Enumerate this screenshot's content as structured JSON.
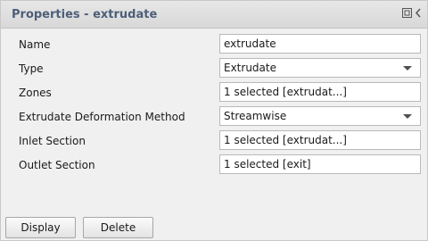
{
  "panel": {
    "title": "Properties - extrudate",
    "icons": [
      "undock-icon",
      "collapse-icon"
    ]
  },
  "properties": [
    {
      "label": "Name",
      "value": "extrudate",
      "kind": "text"
    },
    {
      "label": "Type",
      "value": "Extrudate",
      "kind": "select"
    },
    {
      "label": "Zones",
      "value": "1 selected [extrudat...]",
      "kind": "text"
    },
    {
      "label": "Extrudate Deformation Method",
      "value": "Streamwise",
      "kind": "select"
    },
    {
      "label": "Inlet Section",
      "value": "1 selected [extrudat...]",
      "kind": "text"
    },
    {
      "label": "Outlet Section",
      "value": "1 selected [exit]",
      "kind": "text"
    }
  ],
  "buttons": {
    "display": "Display",
    "delete": "Delete"
  }
}
